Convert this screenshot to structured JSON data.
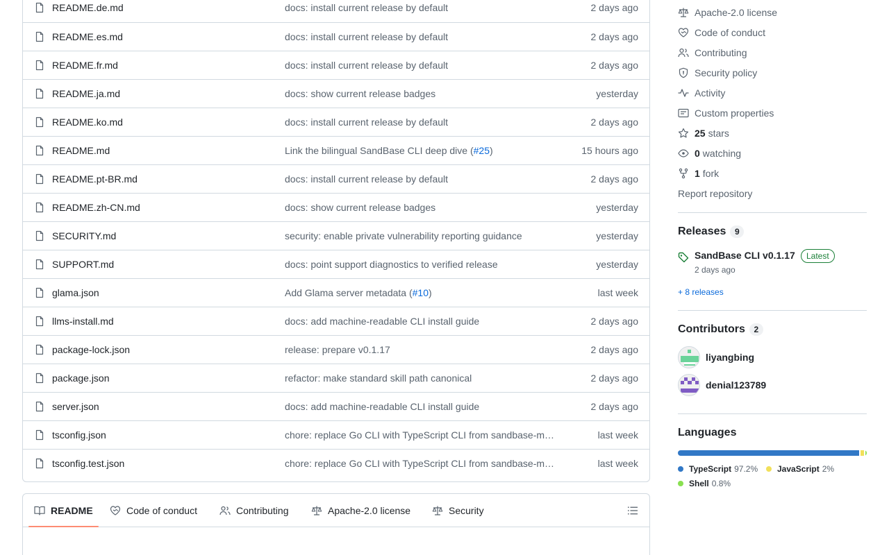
{
  "files": [
    {
      "name": "README.de.md",
      "message": "docs: install current release by default",
      "link": "",
      "msg_suffix": "",
      "date": "2 days ago"
    },
    {
      "name": "README.es.md",
      "message": "docs: install current release by default",
      "link": "",
      "msg_suffix": "",
      "date": "2 days ago"
    },
    {
      "name": "README.fr.md",
      "message": "docs: install current release by default",
      "link": "",
      "msg_suffix": "",
      "date": "2 days ago"
    },
    {
      "name": "README.ja.md",
      "message": "docs: show current release badges",
      "link": "",
      "msg_suffix": "",
      "date": "yesterday"
    },
    {
      "name": "README.ko.md",
      "message": "docs: install current release by default",
      "link": "",
      "msg_suffix": "",
      "date": "2 days ago"
    },
    {
      "name": "README.md",
      "message": "Link the bilingual SandBase CLI deep dive (",
      "link": "#25",
      "msg_suffix": ")",
      "date": "15 hours ago"
    },
    {
      "name": "README.pt-BR.md",
      "message": "docs: install current release by default",
      "link": "",
      "msg_suffix": "",
      "date": "2 days ago"
    },
    {
      "name": "README.zh-CN.md",
      "message": "docs: show current release badges",
      "link": "",
      "msg_suffix": "",
      "date": "yesterday"
    },
    {
      "name": "SECURITY.md",
      "message": "security: enable private vulnerability reporting guidance",
      "link": "",
      "msg_suffix": "",
      "date": "yesterday"
    },
    {
      "name": "SUPPORT.md",
      "message": "docs: point support diagnostics to verified release",
      "link": "",
      "msg_suffix": "",
      "date": "yesterday"
    },
    {
      "name": "glama.json",
      "message": "Add Glama server metadata (",
      "link": "#10",
      "msg_suffix": ")",
      "date": "last week"
    },
    {
      "name": "llms-install.md",
      "message": "docs: add machine-readable CLI install guide",
      "link": "",
      "msg_suffix": "",
      "date": "2 days ago"
    },
    {
      "name": "package-lock.json",
      "message": "release: prepare v0.1.17",
      "link": "",
      "msg_suffix": "",
      "date": "2 days ago"
    },
    {
      "name": "package.json",
      "message": "refactor: make standard skill path canonical",
      "link": "",
      "msg_suffix": "",
      "date": "2 days ago"
    },
    {
      "name": "server.json",
      "message": "docs: add machine-readable CLI install guide",
      "link": "",
      "msg_suffix": "",
      "date": "2 days ago"
    },
    {
      "name": "tsconfig.json",
      "message": "chore: replace Go CLI with TypeScript CLI from sandbase-m…",
      "link": "",
      "msg_suffix": "",
      "date": "last week"
    },
    {
      "name": "tsconfig.test.json",
      "message": "chore: replace Go CLI with TypeScript CLI from sandbase-m…",
      "link": "",
      "msg_suffix": "",
      "date": "last week"
    }
  ],
  "readme_tabs": [
    {
      "label": "README",
      "icon": "book-icon",
      "active": true
    },
    {
      "label": "Code of conduct",
      "icon": "heart-handshake-icon",
      "active": false
    },
    {
      "label": "Contributing",
      "icon": "people-icon",
      "active": false
    },
    {
      "label": "Apache-2.0 license",
      "icon": "scale-icon",
      "active": false
    },
    {
      "label": "Security",
      "icon": "scale-icon",
      "active": false
    }
  ],
  "sidebar": {
    "links": [
      {
        "label": "Apache-2.0 license",
        "icon": "scale-icon",
        "count": ""
      },
      {
        "label": "Code of conduct",
        "icon": "heart-handshake-icon",
        "count": ""
      },
      {
        "label": "Contributing",
        "icon": "people-icon",
        "count": ""
      },
      {
        "label": "Security policy",
        "icon": "shield-icon",
        "count": ""
      },
      {
        "label": "Activity",
        "icon": "pulse-icon",
        "count": ""
      },
      {
        "label": "Custom properties",
        "icon": "note-icon",
        "count": ""
      },
      {
        "label": "stars",
        "icon": "star-icon",
        "count": "25"
      },
      {
        "label": "watching",
        "icon": "eye-icon",
        "count": "0"
      },
      {
        "label": "fork",
        "icon": "repo-forked-icon",
        "count": "1"
      },
      {
        "label": "Report repository",
        "icon": "",
        "count": ""
      }
    ],
    "releases": {
      "title": "Releases",
      "count": "9",
      "latest_name": "SandBase CLI v0.1.17",
      "latest_badge": "Latest",
      "latest_date": "2 days ago",
      "more": "+ 8 releases"
    },
    "contributors": {
      "title": "Contributors",
      "count": "2",
      "people": [
        {
          "name": "liyangbing",
          "color": "#6bd39a"
        },
        {
          "name": "denial123789",
          "color": "#7f5cc4"
        }
      ]
    },
    "languages": {
      "title": "Languages",
      "items": [
        {
          "name": "TypeScript",
          "percent": "97.2%",
          "value": 97.2,
          "color": "#3178c6"
        },
        {
          "name": "JavaScript",
          "percent": "2%",
          "value": 2.0,
          "color": "#f1e05a"
        },
        {
          "name": "Shell",
          "percent": "0.8%",
          "value": 0.8,
          "color": "#89e051"
        }
      ]
    }
  }
}
